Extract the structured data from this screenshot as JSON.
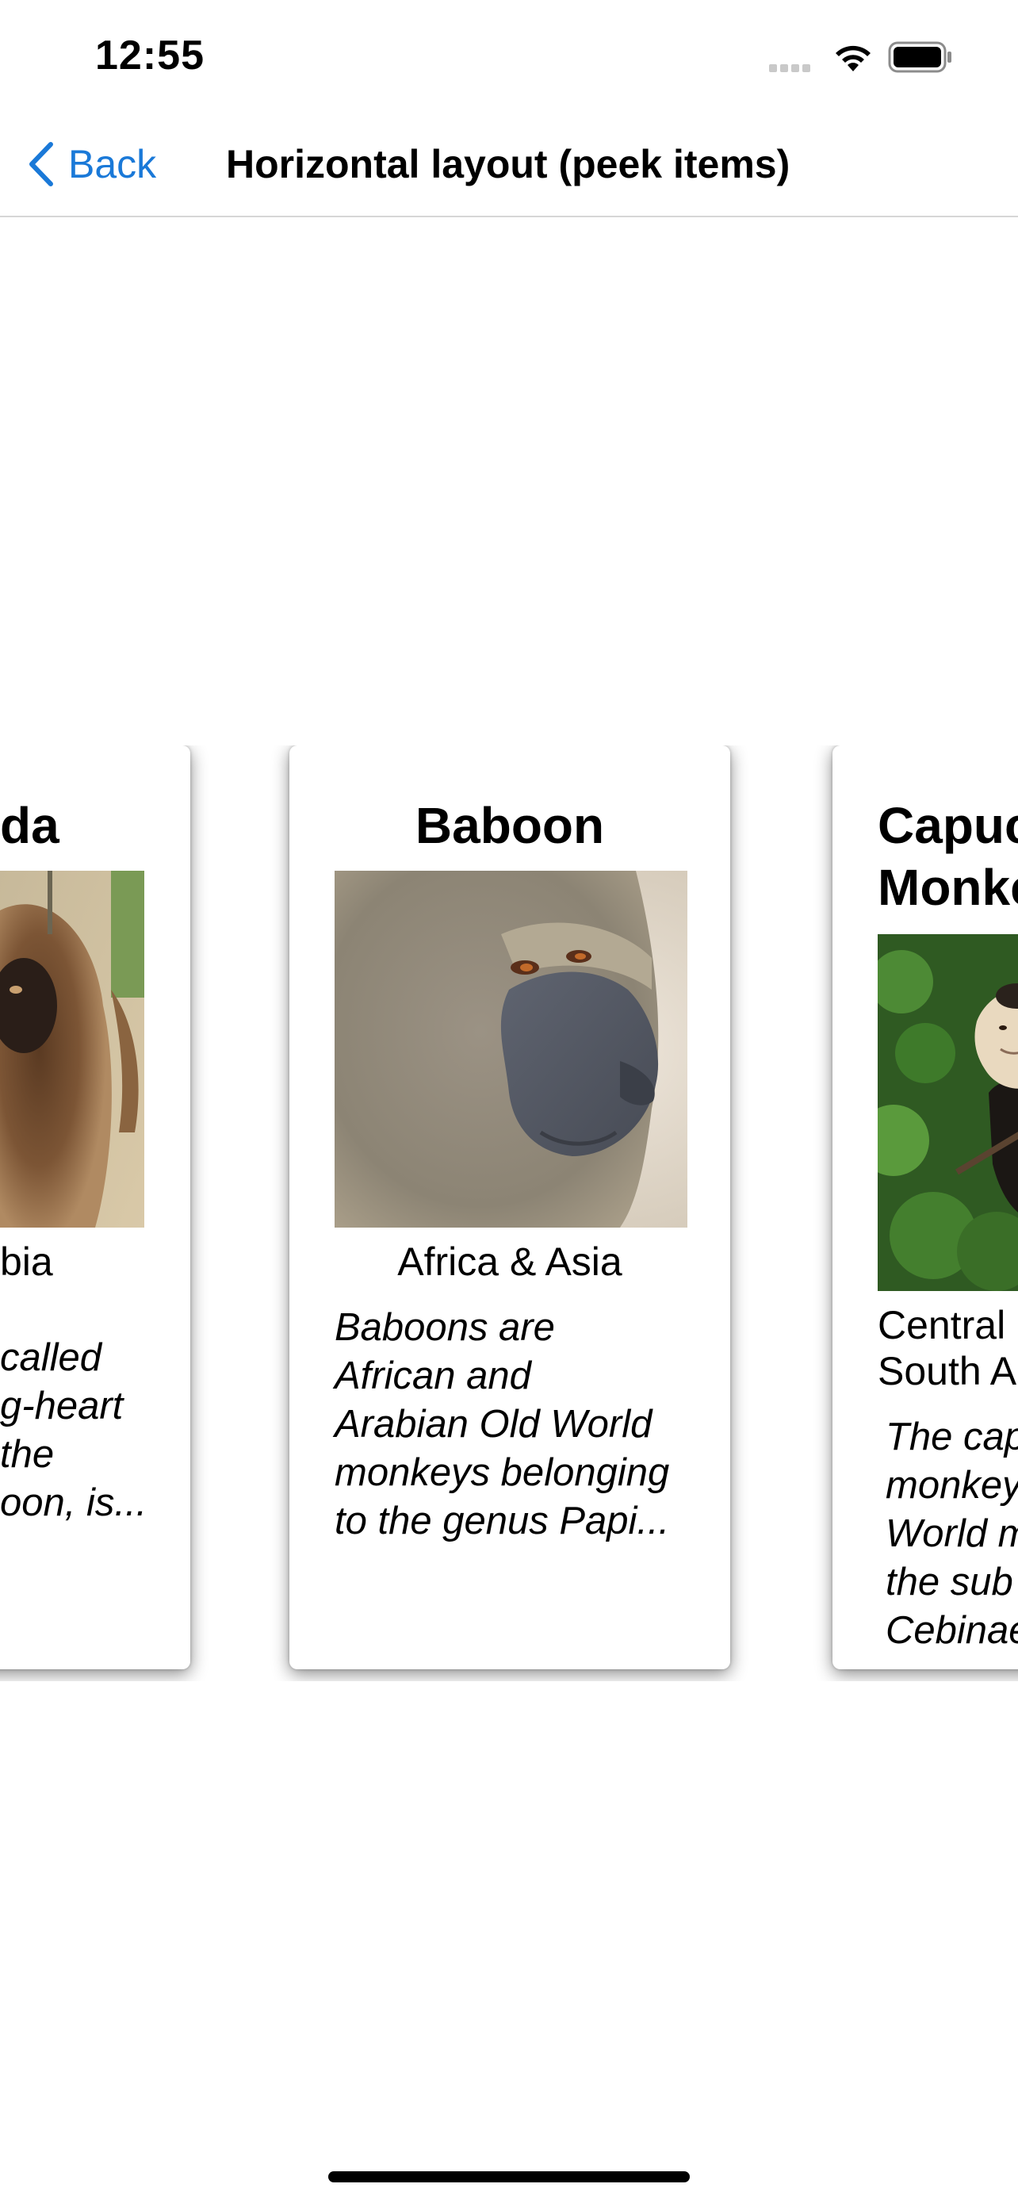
{
  "status_bar": {
    "time": "12:55"
  },
  "nav": {
    "back_label": "Back",
    "title": "Horizontal layout (peek items)"
  },
  "cards": [
    {
      "title_fragment": "da",
      "region_fragment": "bia",
      "desc_lines": [
        "called",
        "g-heart",
        "the",
        "oon, is..."
      ],
      "image": "gelada-photo"
    },
    {
      "title": "Baboon",
      "region": "Africa & Asia",
      "desc_lines": [
        "Baboons are",
        "African and",
        "Arabian Old World",
        "monkeys belonging",
        "to the genus Papi..."
      ],
      "image": "baboon-photo"
    },
    {
      "title_lines": [
        "Capuc",
        "Monke"
      ],
      "region_lines": [
        "Central",
        "South A"
      ],
      "desc_lines": [
        "The cap",
        "monkey",
        "World m",
        "the sub",
        "Cebinae"
      ],
      "image": "capuchin-photo"
    }
  ],
  "colors": {
    "accent": "#1a79d8",
    "separator": "#d6d6d6",
    "home_indicator": "#000000"
  }
}
